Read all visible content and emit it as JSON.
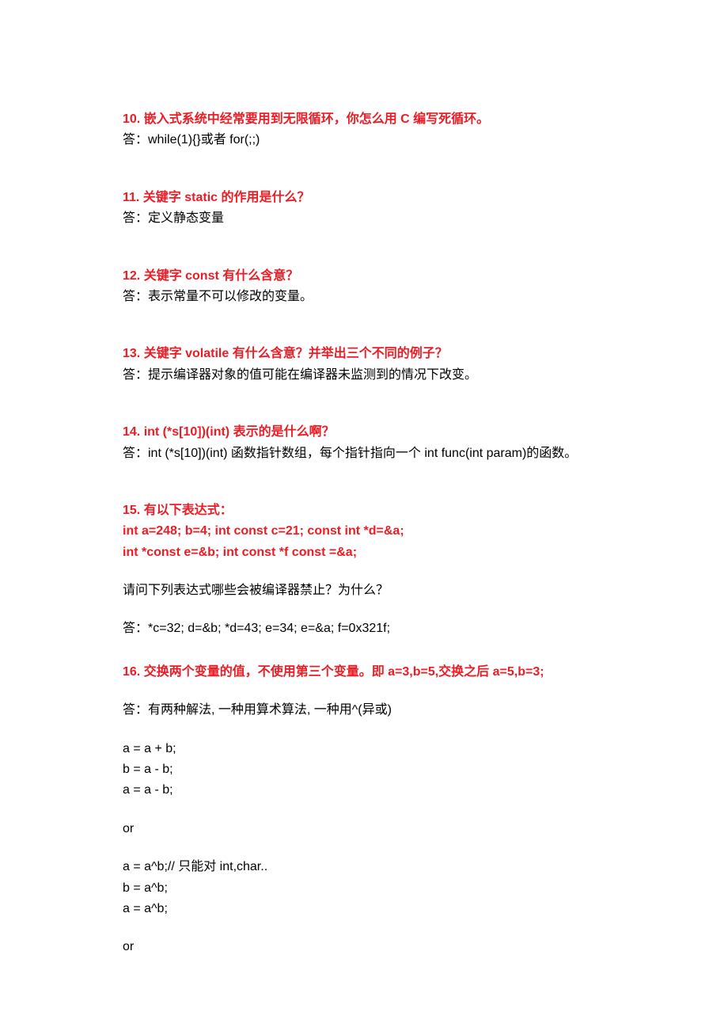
{
  "q10": {
    "question": "10. 嵌入式系统中经常要用到无限循环，你怎么用 C 编写死循环。",
    "answer": "答：while(1){}或者 for(;;)"
  },
  "q11": {
    "question": "11. 关键字 static 的作用是什么？",
    "answer": "答：定义静态变量"
  },
  "q12": {
    "question": "12. 关键字 const 有什么含意？",
    "answer": "答：表示常量不可以修改的变量。"
  },
  "q13": {
    "question": "13. 关键字 volatile 有什么含意？并举出三个不同的例子？",
    "answer": "答：提示编译器对象的值可能在编译器未监测到的情况下改变。"
  },
  "q14": {
    "question": "14. int (*s[10])(int) 表示的是什么啊？",
    "answer": "答：int (*s[10])(int) 函数指针数组，每个指针指向一个 int func(int param)的函数。"
  },
  "q15": {
    "question_l1": "15. 有以下表达式：",
    "question_l2": "int a=248; b=4; int const c=21; const int *d=&a;",
    "question_l3": "int *const e=&b; int const *f const =&a;",
    "sub": "请问下列表达式哪些会被编译器禁止？为什么？",
    "answer": "答：*c=32; d=&b; *d=43; e=34; e=&a; f=0x321f;"
  },
  "q16": {
    "question": "16. 交换两个变量的值，不使用第三个变量。即 a=3,b=5,交换之后 a=5,b=3;",
    "answer_intro": "答：有两种解法, 一种用算术算法, 一种用^(异或)",
    "code1_l1": "a = a + b;",
    "code1_l2": "b = a - b;",
    "code1_l3": "a = a - b;",
    "or1": "or",
    "code2_l1": "a = a^b;// 只能对 int,char..",
    "code2_l2": "b = a^b;",
    "code2_l3": "a = a^b;",
    "or2": "or"
  }
}
